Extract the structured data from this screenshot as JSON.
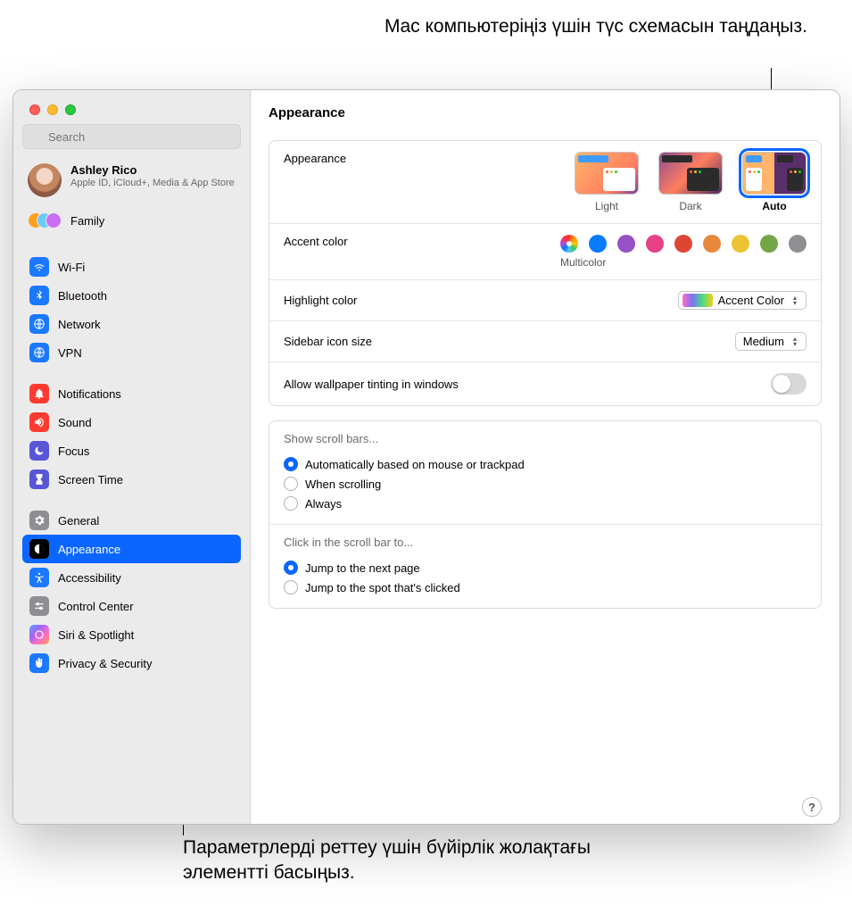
{
  "callouts": {
    "top": "Mac компьютеріңіз үшін түс схемасын таңдаңыз.",
    "bottom": "Параметрлерді реттеу үшін бүйірлік жолақтағы элементті басыңыз."
  },
  "search": {
    "placeholder": "Search"
  },
  "user": {
    "name": "Ashley Rico",
    "subtitle": "Apple ID, iCloud+, Media & App Store"
  },
  "family": {
    "label": "Family"
  },
  "sidebar": {
    "g1": [
      {
        "label": "Wi-Fi",
        "icon": "wifi",
        "bg": "bg-blue"
      },
      {
        "label": "Bluetooth",
        "icon": "bluetooth",
        "bg": "bg-blue"
      },
      {
        "label": "Network",
        "icon": "globe",
        "bg": "bg-blue"
      },
      {
        "label": "VPN",
        "icon": "globe",
        "bg": "bg-blue"
      }
    ],
    "g2": [
      {
        "label": "Notifications",
        "icon": "bell",
        "bg": "bg-red"
      },
      {
        "label": "Sound",
        "icon": "speaker",
        "bg": "bg-red"
      },
      {
        "label": "Focus",
        "icon": "moon",
        "bg": "bg-indigo"
      },
      {
        "label": "Screen Time",
        "icon": "hourglass",
        "bg": "bg-indigo"
      }
    ],
    "g3": [
      {
        "label": "General",
        "icon": "gear",
        "bg": "bg-gray"
      },
      {
        "label": "Appearance",
        "icon": "appearance",
        "bg": "bg-black",
        "selected": true
      },
      {
        "label": "Accessibility",
        "icon": "accessibility",
        "bg": "bg-blue"
      },
      {
        "label": "Control Center",
        "icon": "sliders",
        "bg": "bg-gray"
      },
      {
        "label": "Siri & Spotlight",
        "icon": "siri",
        "bg": "bg-siri"
      },
      {
        "label": "Privacy & Security",
        "icon": "hand",
        "bg": "bg-blue"
      }
    ]
  },
  "header": {
    "title": "Appearance"
  },
  "appearance": {
    "label": "Appearance",
    "options": [
      {
        "label": "Light",
        "mode": "light"
      },
      {
        "label": "Dark",
        "mode": "dark"
      },
      {
        "label": "Auto",
        "mode": "auto",
        "selected": true
      }
    ]
  },
  "accent": {
    "label": "Accent color",
    "subtitle": "Multicolor",
    "colors": [
      "multi",
      "blue",
      "purple",
      "pink",
      "red",
      "orange",
      "yellow",
      "green",
      "gray"
    ],
    "selected": "multi"
  },
  "highlight": {
    "label": "Highlight color",
    "value": "Accent Color"
  },
  "sidebar_size": {
    "label": "Sidebar icon size",
    "value": "Medium"
  },
  "tinting": {
    "label": "Allow wallpaper tinting in windows",
    "on": false
  },
  "scrollbars": {
    "title": "Show scroll bars...",
    "options": [
      "Automatically based on mouse or trackpad",
      "When scrolling",
      "Always"
    ],
    "selected": 0
  },
  "scrollclick": {
    "title": "Click in the scroll bar to...",
    "options": [
      "Jump to the next page",
      "Jump to the spot that's clicked"
    ],
    "selected": 0
  },
  "help": {
    "label": "?"
  }
}
